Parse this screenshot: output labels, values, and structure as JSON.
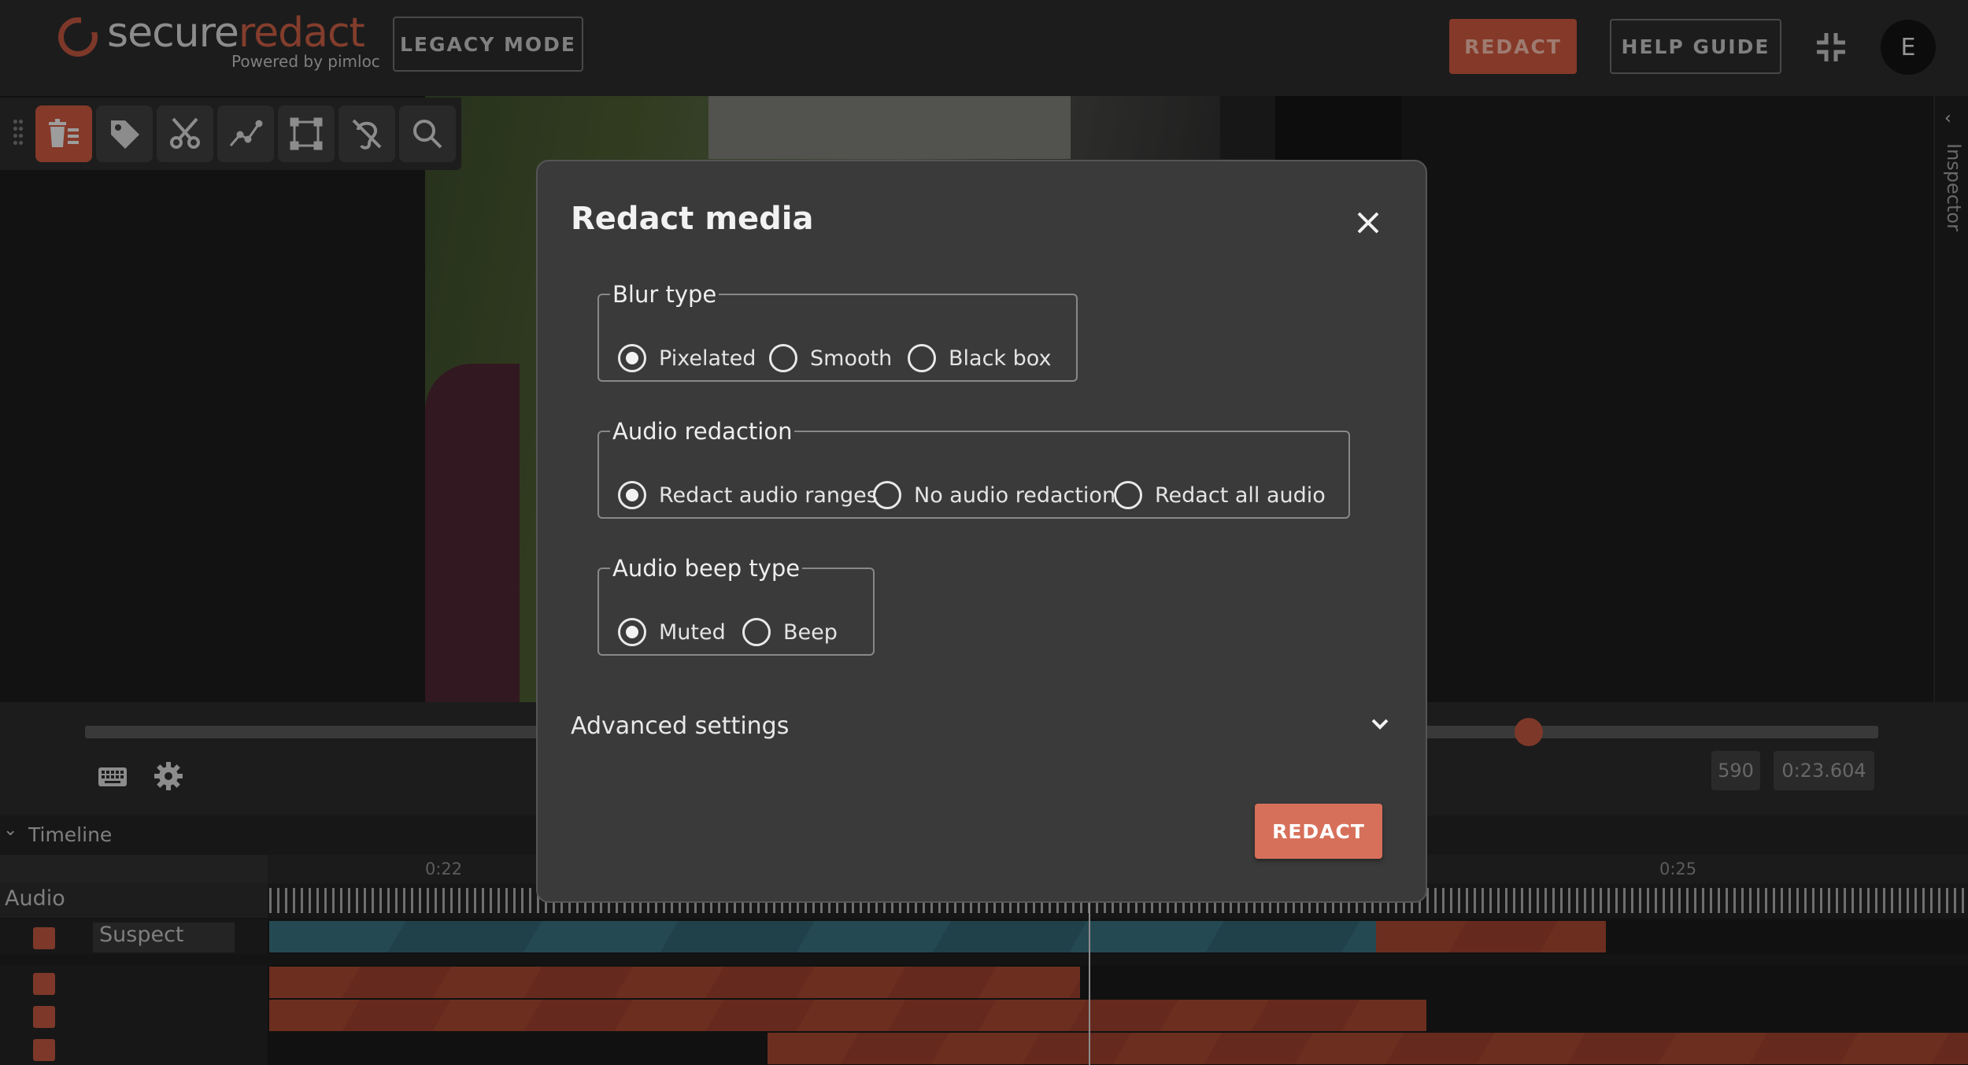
{
  "header": {
    "logo_secure": "secure",
    "logo_redact": "redact",
    "logo_powered": "Powered by pimloc",
    "legacy_mode": "LEGACY MODE",
    "redact": "REDACT",
    "help_guide": "HELP GUIDE",
    "avatar_initial": "E"
  },
  "inspector": {
    "label": "Inspector"
  },
  "player": {
    "frame": "590",
    "time": "0:23.604"
  },
  "timeline": {
    "title": "Timeline",
    "ticks": [
      "0:22",
      "0:25"
    ],
    "audio_label": "Audio",
    "tracks": [
      {
        "name": "Suspect"
      }
    ]
  },
  "modal": {
    "title": "Redact media",
    "blur_type": {
      "legend": "Blur type",
      "options": [
        "Pixelated",
        "Smooth",
        "Black box"
      ],
      "selected": "Pixelated"
    },
    "audio_redaction": {
      "legend": "Audio redaction",
      "options": [
        "Redact audio ranges",
        "No audio redaction",
        "Redact all audio"
      ],
      "selected": "Redact audio ranges"
    },
    "audio_beep": {
      "legend": "Audio beep type",
      "options": [
        "Muted",
        "Beep"
      ],
      "selected": "Muted"
    },
    "advanced_settings": "Advanced settings",
    "redact_button": "REDACT"
  },
  "colors": {
    "accent": "#c4553b",
    "teal_track": "#376c7b"
  },
  "icons": [
    "redact-list-icon",
    "tag-icon",
    "scissors-icon",
    "track-icon",
    "bounding-box-icon",
    "audio-off-icon",
    "search-icon",
    "keyboard-icon",
    "gear-icon",
    "close-icon",
    "chevron-down-icon",
    "exit-fullscreen-icon"
  ]
}
